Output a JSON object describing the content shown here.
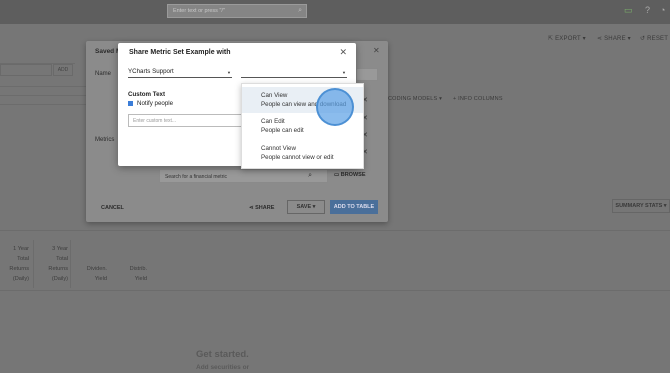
{
  "top_search": {
    "placeholder": "Enter text or press \"/\""
  },
  "toolbar": {
    "export": "EXPORT",
    "share": "SHARE",
    "reset": "RESET"
  },
  "left_input_button": "ADD",
  "coding": {
    "models": "CODING MODELS",
    "info_columns": "+ INFO COLUMNS"
  },
  "summary_stats": "SUMMARY STATS",
  "columns": [
    {
      "l1": "1 Year",
      "l2": "Total",
      "l3": "Returns",
      "l4": "(Daily)"
    },
    {
      "l1": "3 Year",
      "l2": "Total",
      "l3": "Returns",
      "l4": "(Daily)"
    },
    {
      "l1": "Dividen.",
      "l2": "Yield"
    },
    {
      "l1": "Distrib.",
      "l2": "Yield"
    }
  ],
  "get_started": {
    "title": "Get started.",
    "sub": "Add securities or"
  },
  "saved_modal": {
    "title_fragment": "Saved M",
    "name_label": "Name",
    "metrics_label": "Metrics",
    "search_placeholder": "Search for a financial metric",
    "browse": "BROWSE",
    "cancel": "CANCEL",
    "share": "SHARE",
    "save": "SAVE",
    "add_to_table": "ADD TO TABLE"
  },
  "share_dialog": {
    "title": "Share Metric Set Example with",
    "recipient": "YCharts Support",
    "permission": "",
    "custom_text_label": "Custom Text",
    "notify_label": "Notify people",
    "custom_text_placeholder": "Enter custom text..."
  },
  "permission_menu": [
    {
      "title": "Can View",
      "desc": "People can view and download"
    },
    {
      "title": "Can Edit",
      "desc": "People can edit"
    },
    {
      "title": "Cannot View",
      "desc": "People cannot view or edit"
    }
  ]
}
